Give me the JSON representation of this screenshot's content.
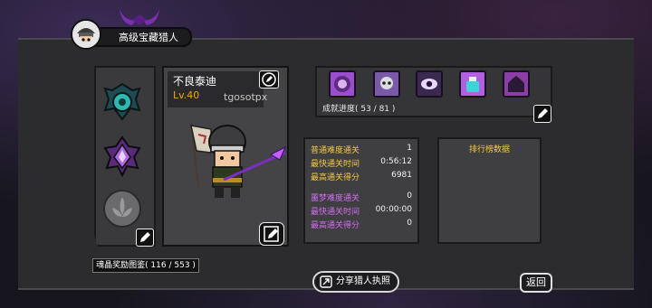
{
  "title": {
    "label": "高级宝藏猎人"
  },
  "character": {
    "name": "不良泰迪",
    "level": "Lv.40",
    "user_id": "tgosotpx"
  },
  "achievements": {
    "progress_text": "成就进度( 53 / 81 )",
    "icons": [
      "medal-face-icon",
      "medal-skull-icon",
      "medal-eye-icon",
      "medal-potion-icon",
      "medal-castle-icon"
    ]
  },
  "stats": {
    "normal": [
      {
        "label": "普通难度通关",
        "value": "1"
      },
      {
        "label": "最快通关时间",
        "value": "0:56:12"
      },
      {
        "label": "最高通关得分",
        "value": "6981"
      }
    ],
    "nightmare": [
      {
        "label": "噩梦难度通关",
        "value": "0"
      },
      {
        "label": "最快通关时间",
        "value": "00:00:00"
      },
      {
        "label": "最高通关得分",
        "value": "0"
      }
    ]
  },
  "ranking": {
    "title": "排行榜数据"
  },
  "bottom": {
    "reward_text": "魂晶奖励图鉴( 116 / 553 )",
    "share_label": "分享猎人执照",
    "back_label": "返回"
  },
  "colors": {
    "gold": "#f5c842",
    "purple": "#d36cf0",
    "level": "#f0a500"
  }
}
